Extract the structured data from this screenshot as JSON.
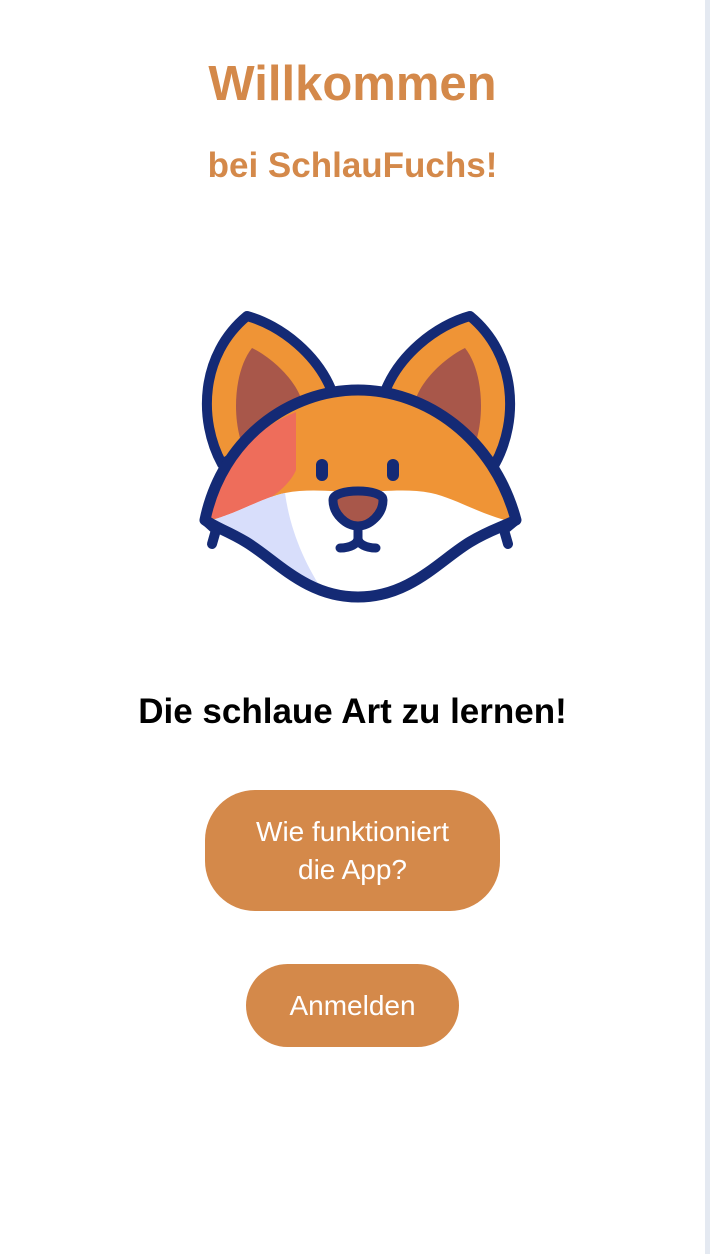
{
  "header": {
    "title": "Willkommen",
    "subtitle": "bei SchlauFuchs!"
  },
  "mascot": {
    "icon": "fox-head-icon"
  },
  "tagline": "Die schlaue Art zu lernen!",
  "buttons": {
    "how_it_works": {
      "line1": "Wie funktioniert",
      "line2": "die App?"
    },
    "login": "Anmelden"
  },
  "colors": {
    "accent": "#d4894a",
    "fox_outline": "#142a75",
    "fox_orange": "#ef9436",
    "fox_ear_inner": "#a8574a",
    "fox_cheek": "#ee6d5b",
    "fox_white_shade": "#d8defb"
  }
}
